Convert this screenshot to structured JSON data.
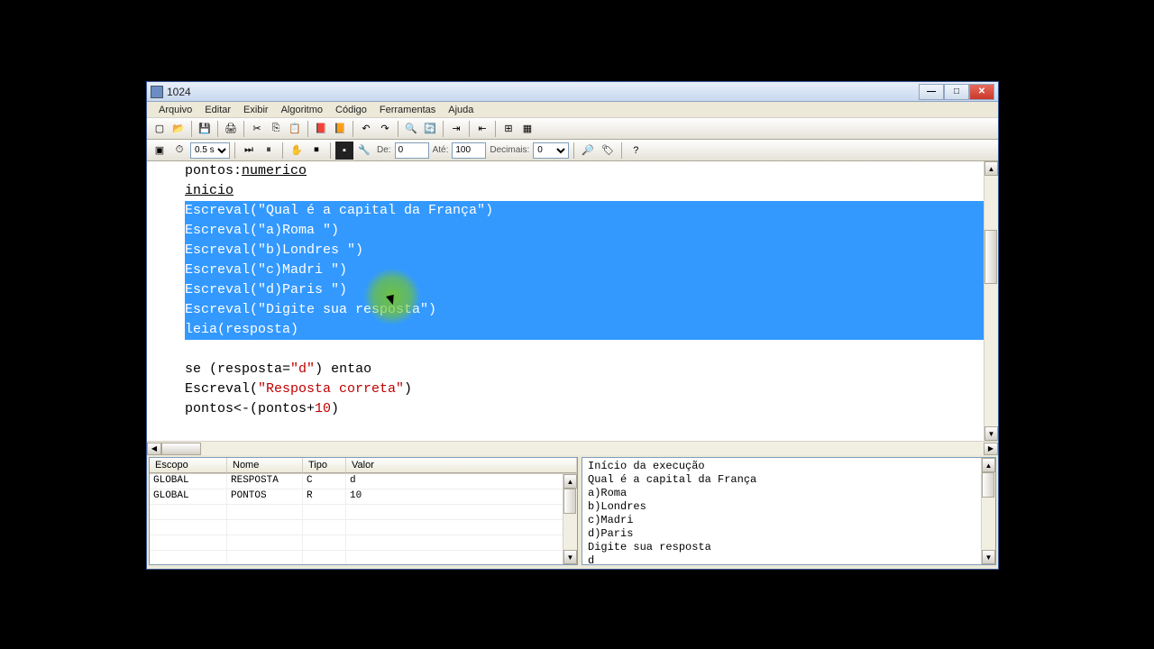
{
  "window": {
    "title": "1024"
  },
  "menu": [
    "Arquivo",
    "Editar",
    "Exibir",
    "Algoritmo",
    "Código",
    "Ferramentas",
    "Ajuda"
  ],
  "toolbar2": {
    "speed": "0.5 s",
    "de_label": "De:",
    "de_value": "0",
    "ate_label": "Até:",
    "ate_value": "100",
    "dec_label": "Decimais:",
    "dec_value": "0"
  },
  "code": {
    "lines": [
      {
        "cls": "",
        "html": "pontos:<span class='type'>numerico</span>"
      },
      {
        "cls": "",
        "html": "<span class='type'>inicio</span>"
      },
      {
        "cls": "selected",
        "html": "Escreval(<span class='str'>\"Qual é a capital da França\"</span>)"
      },
      {
        "cls": "selected",
        "html": "Escreval(<span class='str'>\"a)Roma \"</span>)"
      },
      {
        "cls": "selected",
        "html": "Escreval(<span class='str'>\"b)Londres \"</span>)"
      },
      {
        "cls": "selected",
        "html": "Escreval(<span class='str'>\"c)Madri \"</span>)"
      },
      {
        "cls": "selected",
        "html": "Escreval(<span class='str'>\"d)Paris \"</span>)"
      },
      {
        "cls": "selected",
        "html": "Escreval(<span class='str'>\"Digite sua resposta\"</span>)"
      },
      {
        "cls": "selected",
        "html": "leia(resposta)"
      },
      {
        "cls": "",
        "html": ""
      },
      {
        "cls": "",
        "html": "<span class='kw'>se</span> (resposta=<span class='str'>\"d\"</span>) <span class='kw'>entao</span>"
      },
      {
        "cls": "",
        "html": "Escreval(<span class='str'>\"Resposta correta\"</span>)"
      },
      {
        "cls": "",
        "html": "pontos&lt;-(pontos+<span class='num'>10</span>)"
      }
    ]
  },
  "vars": {
    "headers": {
      "escopo": "Escopo",
      "nome": "Nome",
      "tipo": "Tipo",
      "valor": "Valor"
    },
    "rows": [
      {
        "escopo": "GLOBAL",
        "nome": "RESPOSTA",
        "tipo": "C",
        "valor": "d"
      },
      {
        "escopo": "GLOBAL",
        "nome": "PONTOS",
        "tipo": "R",
        "valor": "10"
      }
    ]
  },
  "output": [
    "Início da execução",
    "Qual é a capital da França",
    "a)Roma",
    "b)Londres",
    "c)Madri",
    "d)Paris",
    "Digite sua resposta",
    "d"
  ]
}
